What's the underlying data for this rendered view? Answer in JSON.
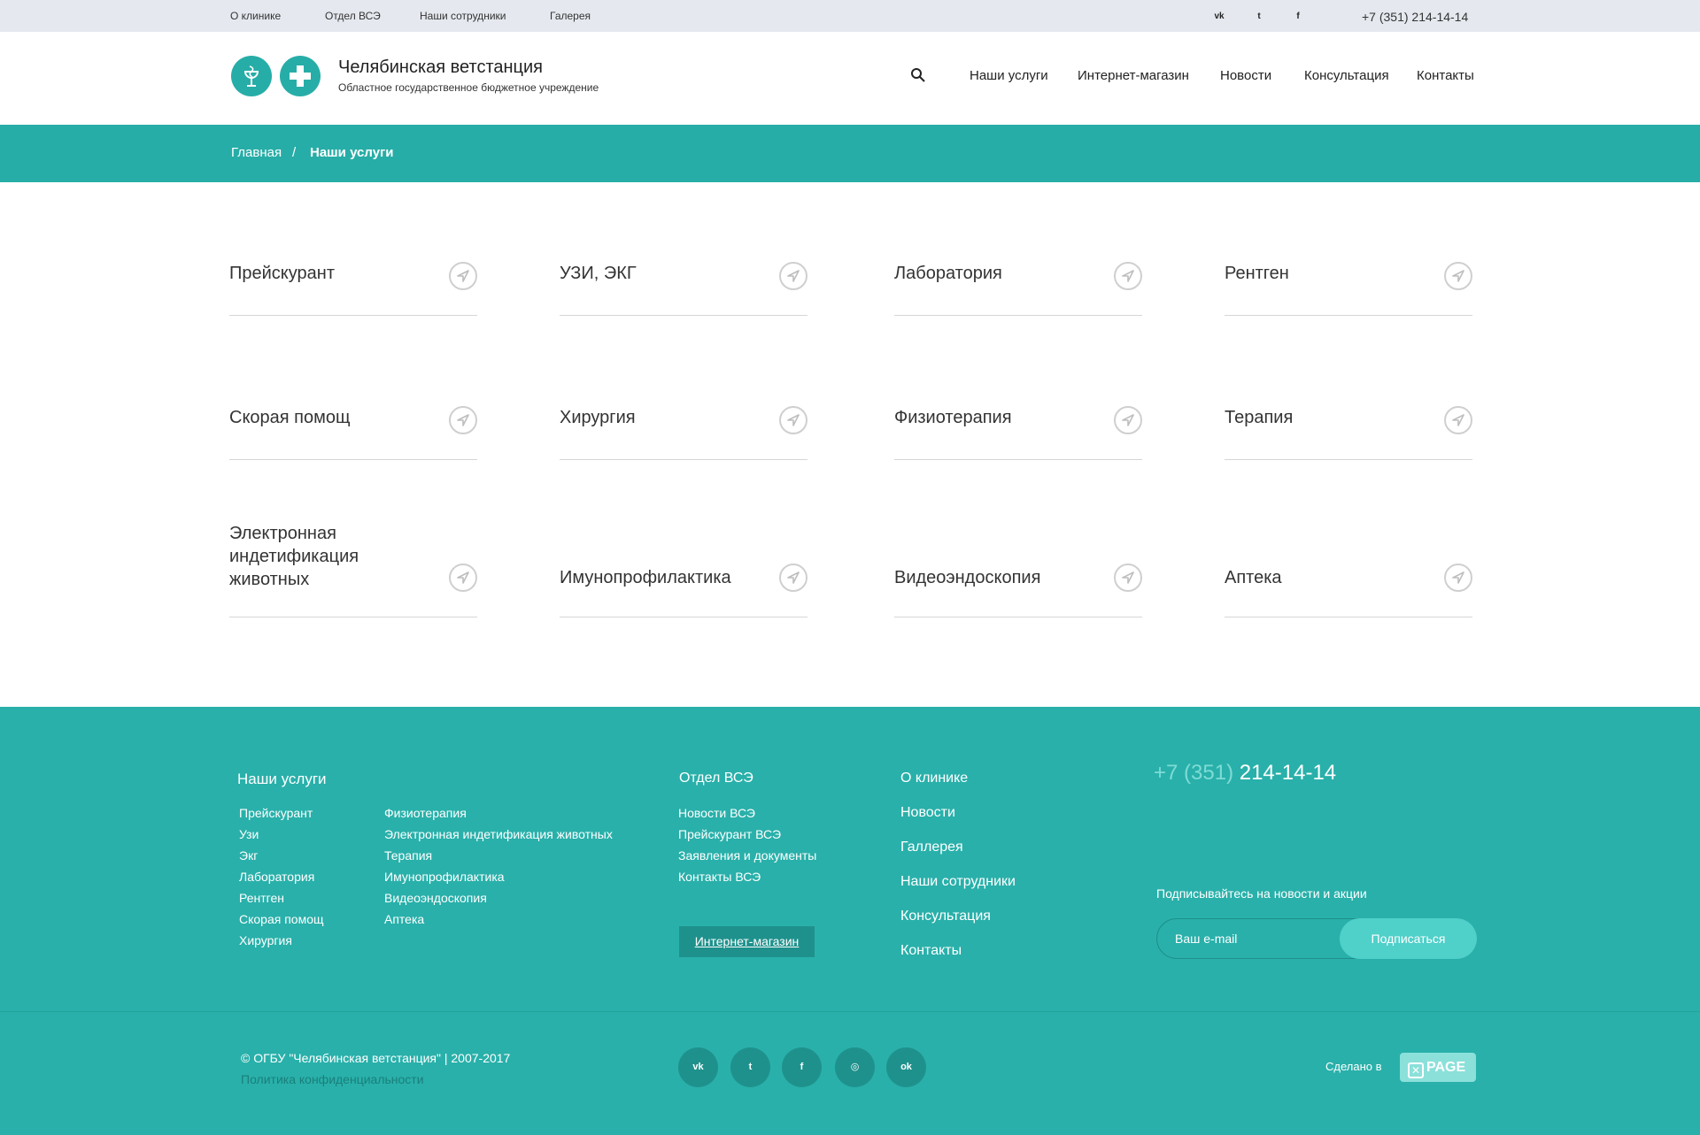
{
  "topbar": {
    "links": [
      "О клинике",
      "Отдел ВСЭ",
      "Наши сотрудники",
      "Галерея"
    ],
    "social": [
      {
        "icon": "vk-icon",
        "glyph": "vk"
      },
      {
        "icon": "twitter-icon",
        "glyph": "t"
      },
      {
        "icon": "facebook-icon",
        "glyph": "f"
      }
    ],
    "phone": "+7 (351) 214-14-14"
  },
  "header": {
    "title": "Челябинская ветстанция",
    "subtitle": "Областное государственное бюджетное учреждение",
    "nav": [
      "Наши услуги",
      "Интернет-магазин",
      "Новости",
      "Консультация",
      "Контакты"
    ]
  },
  "breadcrumb": {
    "home": "Главная",
    "separator": "/",
    "current": "Наши услуги"
  },
  "services": [
    "Прейскурант",
    "УЗИ, ЭКГ",
    "Лаборатория",
    "Рентген",
    "Скорая помощ",
    "Хирургия",
    "Физиотерапия",
    "Терапия",
    "Электронная индетификация животных",
    "Имунопрофилактика",
    "Видеоэндоскопия",
    "Аптека"
  ],
  "footer": {
    "services_title": "Наши услуги",
    "services_col1": [
      "Прейскурант",
      "Узи",
      "Экг",
      "Лаборатория",
      "Рентген",
      "Скорая помощ",
      "Хирургия"
    ],
    "services_col2": [
      "Физиотерапия",
      "Электронная индетификация животных",
      "Терапия",
      "Имунопрофилактика",
      "Видеоэндоскопия",
      "Аптека"
    ],
    "vse_title": "Отдел ВСЭ",
    "vse_links": [
      "Новости ВСЭ",
      "Прейскурант ВСЭ",
      "Заявления и документы",
      "Контакты ВСЭ"
    ],
    "shop_button": "Интернет-магазин",
    "menu": [
      "О клинике",
      "Новости",
      "Галлерея",
      "Наши сотрудники",
      "Консультация",
      "Контакты"
    ],
    "phone_code": "+7 (351)",
    "phone_number": "214-14-14",
    "subscribe_label": "Подписывайтесь на новости и акции",
    "email_placeholder": "Ваш e-mail",
    "subscribe_button": "Подписаться",
    "copyright": "© ОГБУ \"Челябинская ветстанция\" | 2007-2017",
    "policy": "Политика конфиденциальности",
    "social": [
      {
        "icon": "vk-icon",
        "glyph": "vk"
      },
      {
        "icon": "twitter-icon",
        "glyph": "t"
      },
      {
        "icon": "facebook-icon",
        "glyph": "f"
      },
      {
        "icon": "instagram-icon",
        "glyph": "◎"
      },
      {
        "icon": "odnoklassniki-icon",
        "glyph": "ok"
      }
    ],
    "made_in": "Сделано в",
    "made_logo": "PAGE"
  },
  "colors": {
    "accent": "#27ada7",
    "footer_bg": "#29b0aa",
    "topbar_bg": "#e5e9ef"
  }
}
